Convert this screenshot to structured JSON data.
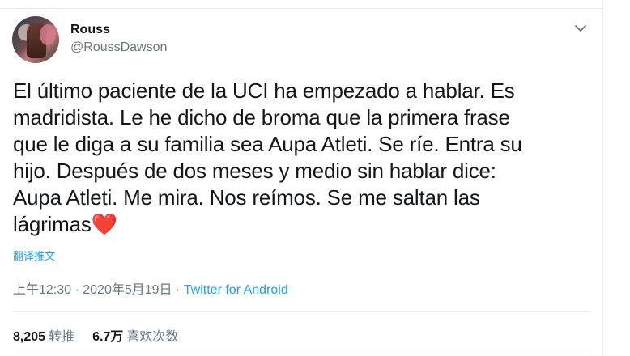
{
  "user": {
    "name": "Rouss",
    "handle": "@RoussDawson"
  },
  "tweet": {
    "lines": [
      "El último paciente de la UCI ha empezado a hablar. Es",
      "madridista. Le he dicho de broma que la primera frase",
      "que le diga a su familia sea Aupa Atleti. Se ríe. Entra su",
      "hijo. Después de dos meses y medio sin hablar dice:",
      "Aupa Atleti. Me mira. Nos reímos. Se me saltan las",
      "lágrimas"
    ],
    "emoji": "❤️",
    "translate_label": "翻译推文",
    "timestamp": "上午12:30 · 2020年5月19日 · ",
    "source": "Twitter for Android"
  },
  "stats": {
    "retweets_count": "8,205",
    "retweets_label": "转推",
    "likes_count": "6.7万",
    "likes_label": "喜欢次数"
  },
  "colors": {
    "link": "#1da1f2",
    "secondary_text": "#657786",
    "heart": "#dd2e44"
  },
  "icons": {
    "menu": "chevron-down-icon",
    "heart": "heart-emoji-icon"
  }
}
